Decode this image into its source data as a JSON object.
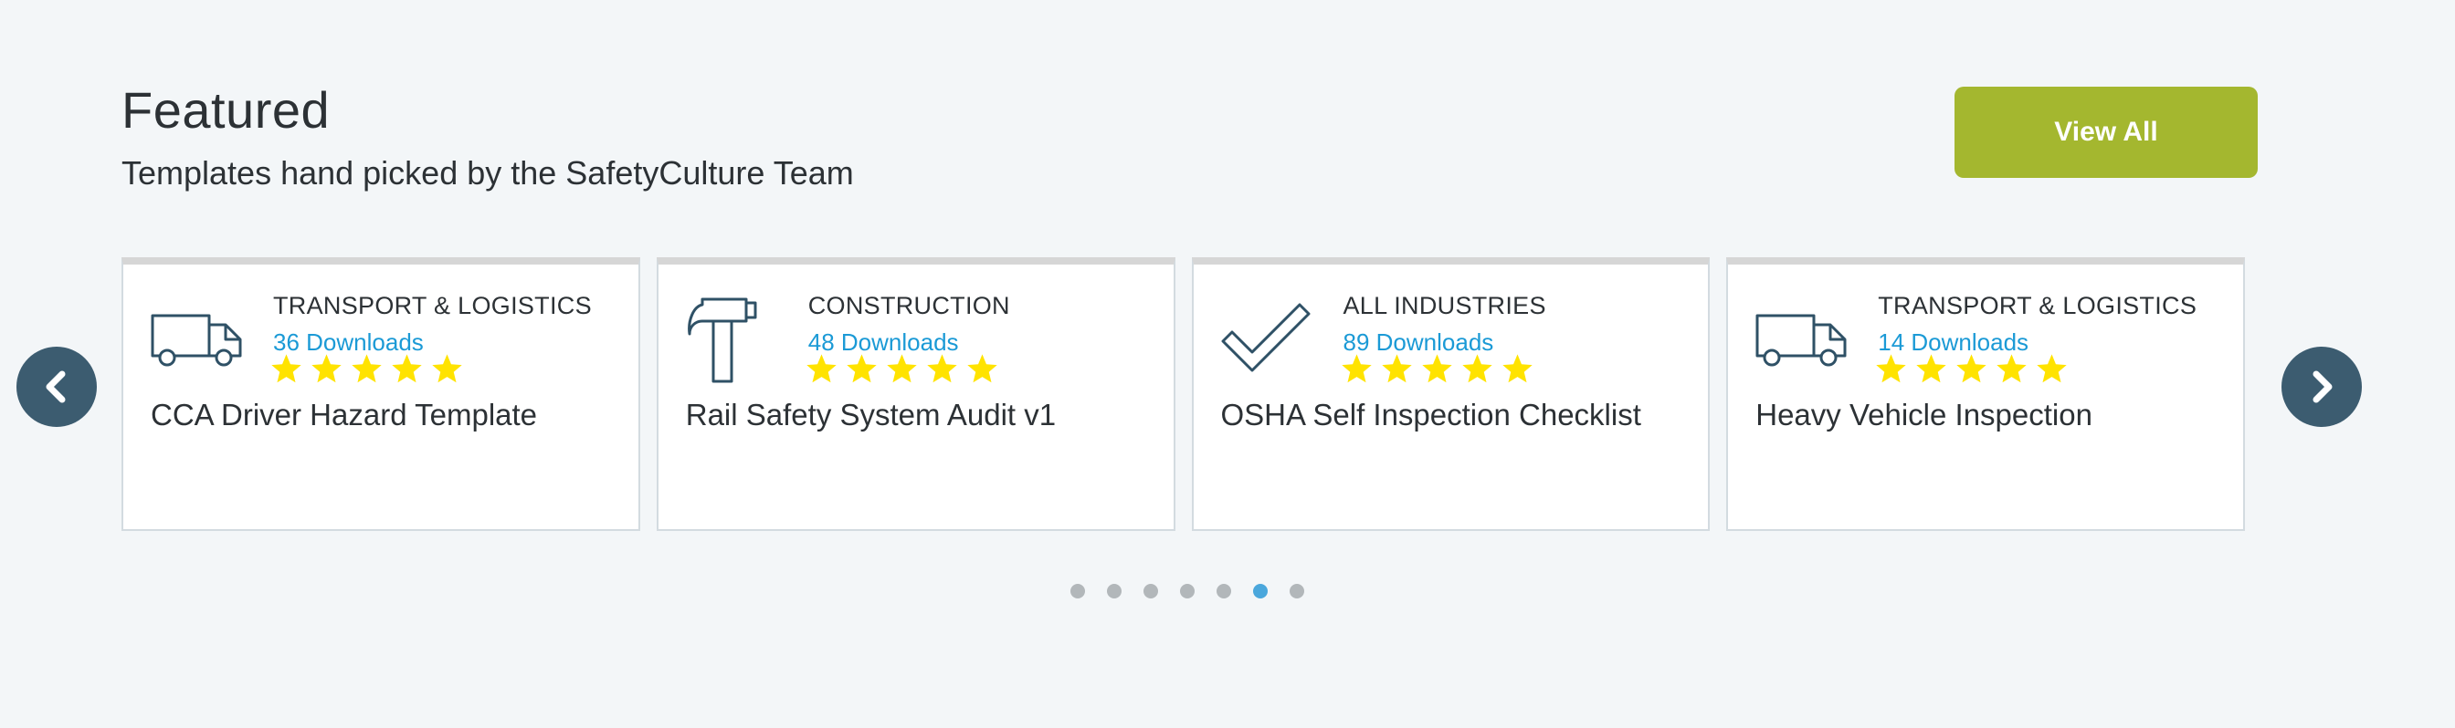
{
  "header": {
    "title": "Featured",
    "subtitle": "Templates hand picked by the SafetyCulture Team",
    "view_all_label": "View All"
  },
  "colors": {
    "accent_button": "#a4b72f",
    "downloads_link": "#1b9ad6",
    "star": "#ffe300",
    "nav_arrow": "#3c5c70",
    "dot_active": "#4aa7dc",
    "dot_inactive": "#b2b7ba",
    "icon_stroke": "#2f5166"
  },
  "cards": [
    {
      "icon": "truck-icon",
      "category": "TRANSPORT & LOGISTICS",
      "downloads": "36 Downloads",
      "rating": 5,
      "title": "CCA Driver Hazard Template"
    },
    {
      "icon": "hammer-icon",
      "category": "CONSTRUCTION",
      "downloads": "48 Downloads",
      "rating": 5,
      "title": "Rail Safety System Audit v1"
    },
    {
      "icon": "checkmark-icon",
      "category": "ALL INDUSTRIES",
      "downloads": "89 Downloads",
      "rating": 5,
      "title": "OSHA Self Inspection Checklist"
    },
    {
      "icon": "truck-icon",
      "category": "TRANSPORT & LOGISTICS",
      "downloads": "14 Downloads",
      "rating": 5,
      "title": "Heavy Vehicle Inspection"
    }
  ],
  "carousel": {
    "prev_icon": "chevron-left-icon",
    "next_icon": "chevron-right-icon",
    "page_count": 7,
    "active_page": 6
  }
}
